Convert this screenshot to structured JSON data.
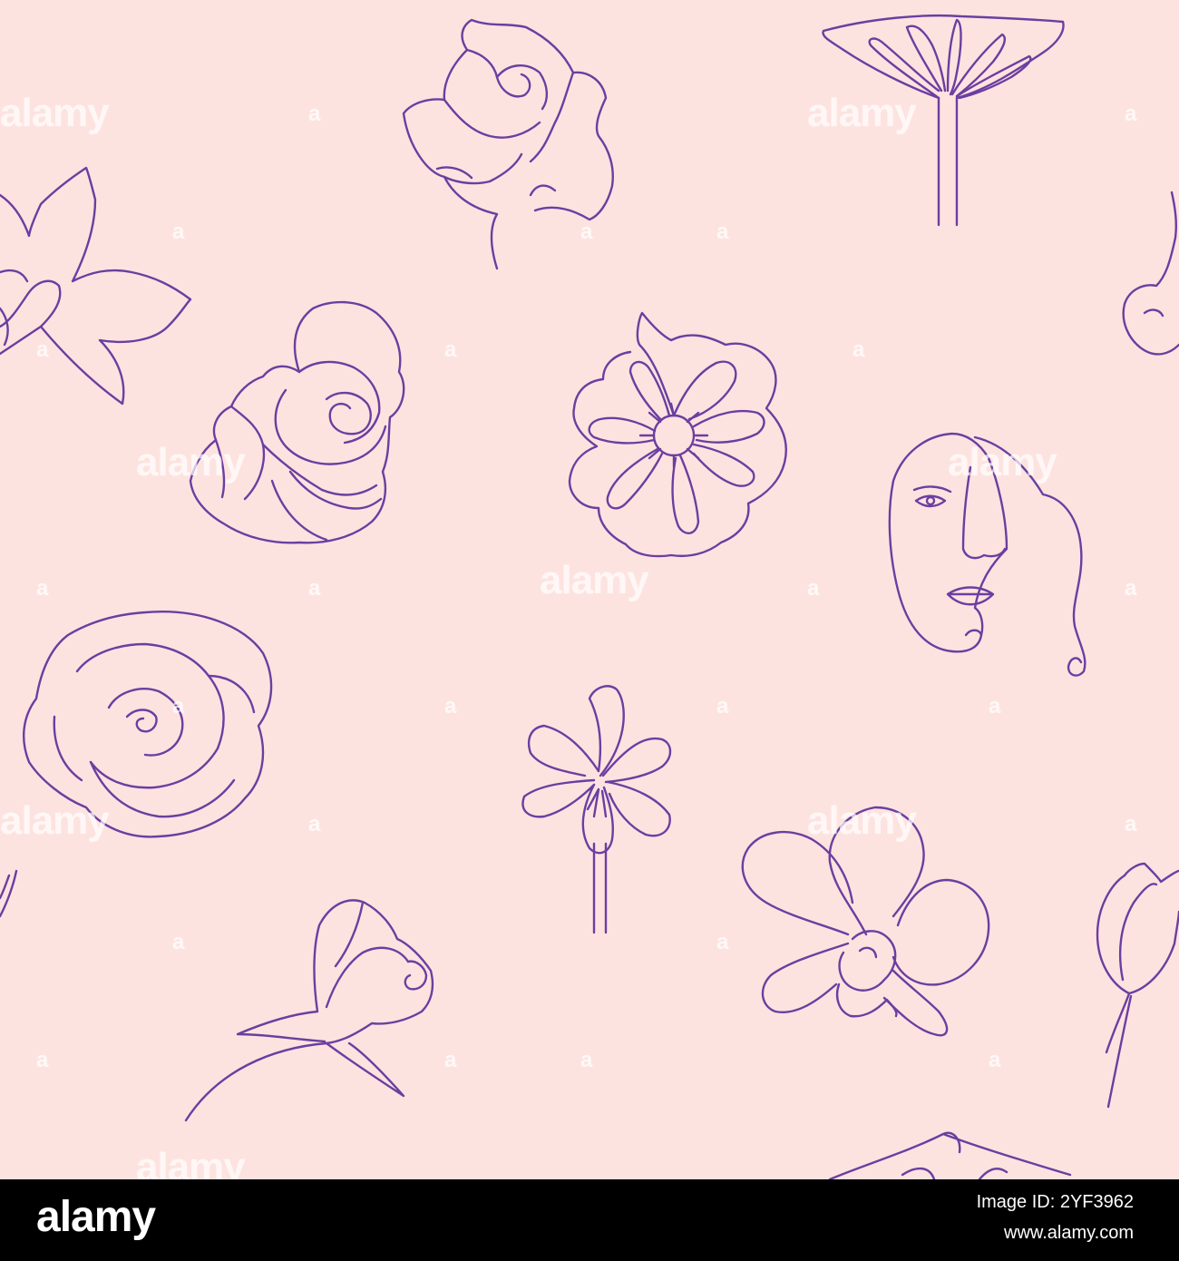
{
  "background_color": "#fde3e0",
  "line_color": "#6a3fa0",
  "watermark": {
    "text": "alamy",
    "small_mark": "a"
  },
  "footer": {
    "logo": "alamy",
    "image_id": "Image ID: 2YF3962",
    "url": "www.alamy.com",
    "background_color": "#000000"
  },
  "illustrations": [
    "rose-bud",
    "lotus-bloom",
    "magnolia-flower",
    "open-rose",
    "dahlia-flower",
    "woman-face",
    "peony-flower",
    "lily-flower",
    "orchid-flower",
    "rose-on-stem",
    "tulip-bud"
  ]
}
